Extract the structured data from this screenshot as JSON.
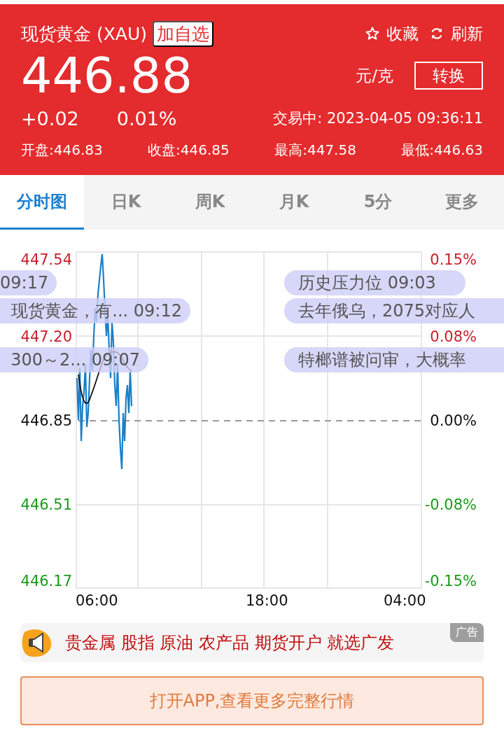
{
  "header": {
    "title": "现货黄金 (XAU)",
    "watchlist_button": "加自选",
    "actions": [
      {
        "kind": "star",
        "label": "收藏"
      },
      {
        "kind": "refresh",
        "label": "刷新"
      }
    ],
    "price": "446.88",
    "unit": "元/克",
    "convert_button": "转换",
    "change": "+0.02",
    "change_percent": "0.01%",
    "status": "交易中: 2023-04-05 09:36:11",
    "stats": [
      "开盘:446.83",
      "收盘:446.85",
      "最高:447.58",
      "最低:446.63"
    ]
  },
  "tabs": [
    {
      "label": "分时图",
      "selected": true
    },
    {
      "label": "日K",
      "selected": false
    },
    {
      "label": "周K",
      "selected": false
    },
    {
      "label": "月K",
      "selected": false
    },
    {
      "label": "5分",
      "selected": false
    },
    {
      "label": "更多",
      "selected": false
    }
  ],
  "chart": {
    "left_labels": [
      {
        "text": "447.54",
        "color": "#c8202c"
      },
      {
        "text": "447.20",
        "color": "#c8202c"
      },
      {
        "text": "446.85",
        "color": "#111111"
      },
      {
        "text": "446.51",
        "color": "#1c9a1c"
      },
      {
        "text": "446.17",
        "color": "#1c9a1c"
      }
    ],
    "right_labels": [
      {
        "text": "0.15%",
        "color": "#c8202c"
      },
      {
        "text": "0.08%",
        "color": "#c8202c"
      },
      {
        "text": "0.00%",
        "color": "#111111"
      },
      {
        "text": "-0.08%",
        "color": "#1c9a1c"
      },
      {
        "text": "-0.15%",
        "color": "#1c9a1c"
      }
    ],
    "x_labels": [
      "06:00",
      "18:00",
      "04:00"
    ],
    "news_left": [
      "09:17",
      "现货黄金，有... 09:12",
      "300～2... 09:07"
    ],
    "news_right": [
      "历史压力位 09:03",
      "去年俄乌，2075对应人",
      "特榔谱被问审，大概率"
    ]
  },
  "ad": {
    "text": "贵金属 股指 原油 农产品 期货开户 就选广发",
    "badge": "广告"
  },
  "open_app_button": "打开APP,查看更多完整行情"
}
